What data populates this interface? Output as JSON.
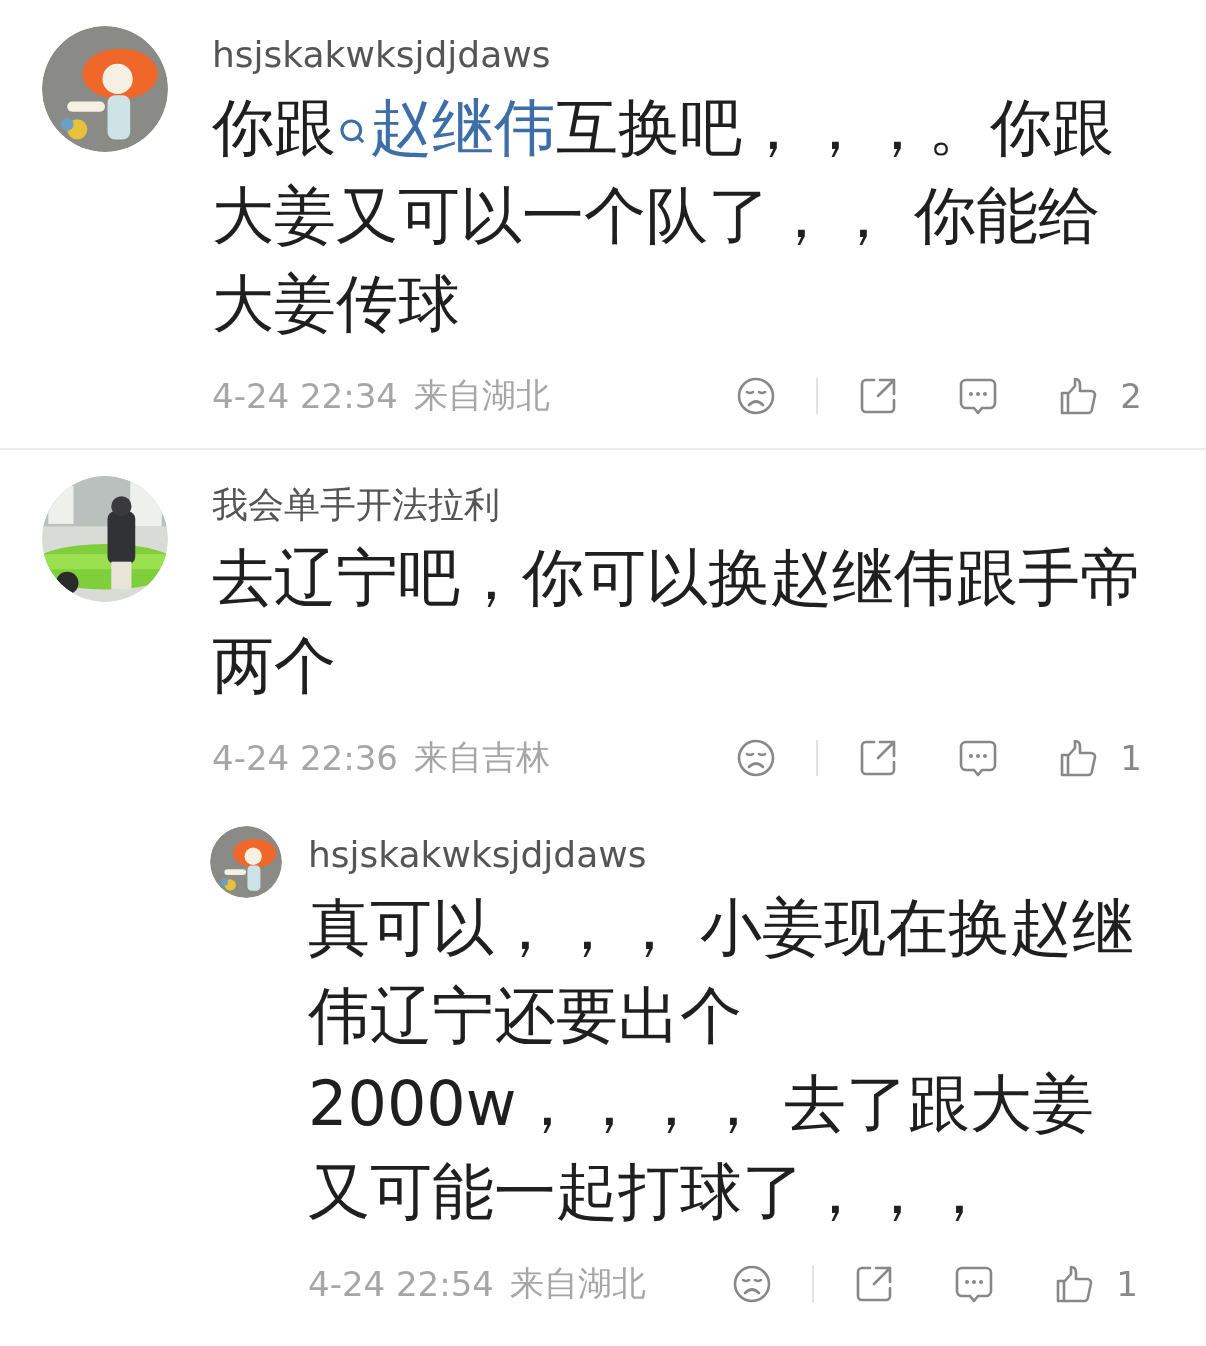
{
  "comments": [
    {
      "avatar": {
        "kind": "picture"
      },
      "username": "hsjskakwksjdjdaws",
      "text": [
        {
          "kind": "text",
          "text": "你跟"
        },
        {
          "kind": "topic",
          "text": "赵继伟"
        },
        {
          "kind": "text",
          "text": "互换吧，，，。你跟大姜又可以一个队了，， 你能给大姜传球"
        }
      ],
      "time": "4-24 22:34",
      "location": "来自湖北",
      "likes": "2"
    },
    {
      "avatar": {
        "kind": "picture"
      },
      "username": "我会单手开法拉利",
      "text": [
        {
          "kind": "text",
          "text": "去辽宁吧，你可以换赵继伟跟手帝两个"
        }
      ],
      "time": "4-24 22:36",
      "location": "来自吉林",
      "likes": "1",
      "replies": [
        {
          "avatar": {
            "kind": "picture"
          },
          "username": "hsjskakwksjdjdaws",
          "text": [
            {
              "kind": "text",
              "text": "真可以，，， 小姜现在换赵继伟辽宁还要出个 2000w，，，， 去了跟大姜又可能一起打球了，，，"
            }
          ],
          "time": "4-24 22:54",
          "location": "来自湖北",
          "likes": "1"
        }
      ]
    }
  ]
}
